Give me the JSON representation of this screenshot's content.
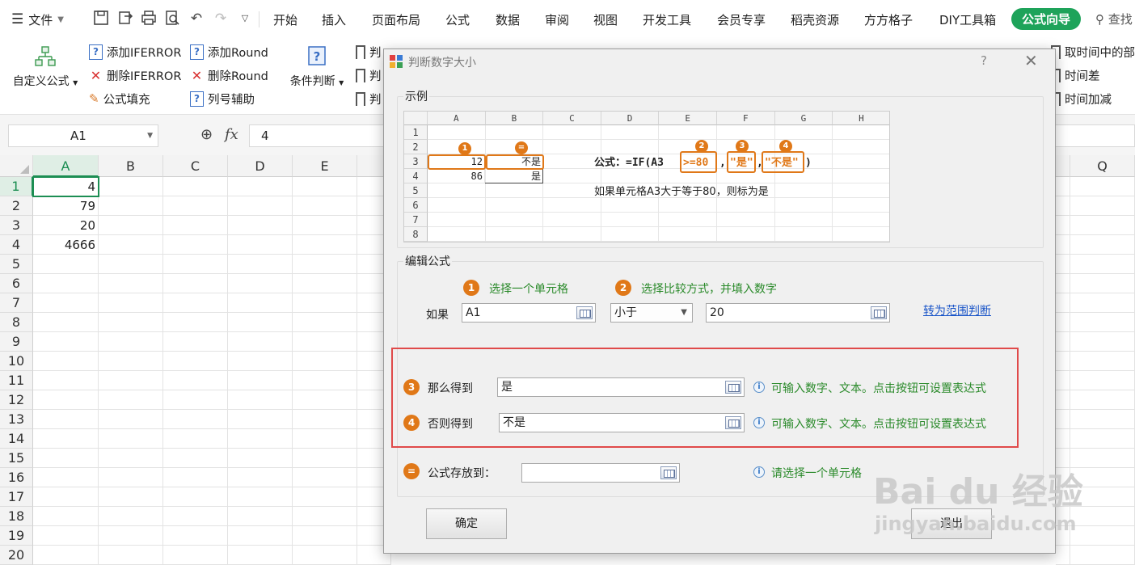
{
  "menubar": {
    "file_label": "文件",
    "tabs": [
      "开始",
      "插入",
      "页面布局",
      "公式",
      "数据",
      "审阅",
      "视图",
      "开发工具",
      "会员专享",
      "稻壳资源",
      "方方格子",
      "DIY工具箱"
    ],
    "active_tab": "公式向导",
    "search_label": "查找"
  },
  "ribbon": {
    "custom_formula_label": "自定义公式",
    "add_iferror": "添加IFERROR",
    "del_iferror": "删除IFERROR",
    "formula_fill": "公式填充",
    "add_round": "添加Round",
    "del_round": "删除Round",
    "col_helper": "列号辅助",
    "cond_judge": "条件判断",
    "judge_prefix": "判",
    "time_take": "取时间中的部",
    "time_diff": "时间差",
    "time_add": "时间加减"
  },
  "formula_bar": {
    "name_box": "A1",
    "value": "4"
  },
  "grid": {
    "columns": [
      "A",
      "B",
      "C",
      "D",
      "E",
      "Q"
    ],
    "rows": [
      "1",
      "2",
      "3",
      "4",
      "5",
      "6",
      "7",
      "8",
      "9",
      "10",
      "11",
      "12",
      "13",
      "14",
      "15",
      "16",
      "17",
      "18",
      "19",
      "20"
    ],
    "values": [
      "4",
      "79",
      "20",
      "4666"
    ]
  },
  "dialog": {
    "title": "判断数字大小",
    "help": "?",
    "example_label": "示例",
    "example": {
      "columns": [
        "A",
        "B",
        "C",
        "D",
        "E",
        "F",
        "G",
        "H"
      ],
      "rows": [
        "1",
        "2",
        "3",
        "4",
        "5",
        "6",
        "7",
        "8"
      ],
      "a3": "12",
      "b3": "不是",
      "a4": "86",
      "b4": "是",
      "formula_prefix": "公式：=IF(A3",
      "formula_cond": ">=80",
      "formula_true": "\"是\"",
      "formula_false": "\"不是\"",
      "formula_end": ")",
      "comma": ",",
      "note": "如果单元格A3大于等于80，则标为是",
      "num1": "1",
      "num2": "2",
      "num3": "3",
      "num4": "4",
      "num_eq": "="
    },
    "edit_label": "编辑公式",
    "step1_hint": "选择一个单元格",
    "step2_hint": "选择比较方式，并填入数字",
    "if_label": "如果",
    "if_cell": "A1",
    "compare_op": "小于",
    "compare_value": "20",
    "range_link": "转为范围判断",
    "then_label": "那么得到",
    "then_value": "是",
    "else_label": "否则得到",
    "else_value": "不是",
    "value_hint": "可输入数字、文本。点击按钮可设置表达式",
    "store_label": "公式存放到：",
    "store_value": "",
    "store_hint": "请选择一个单元格",
    "ok_label": "确定",
    "exit_label": "退出",
    "num1": "1",
    "num2": "2",
    "num3": "3",
    "num4": "4",
    "num_eq": "="
  },
  "watermark": {
    "logo": "Bai du 经验",
    "url": "jingyan.baidu.com"
  }
}
